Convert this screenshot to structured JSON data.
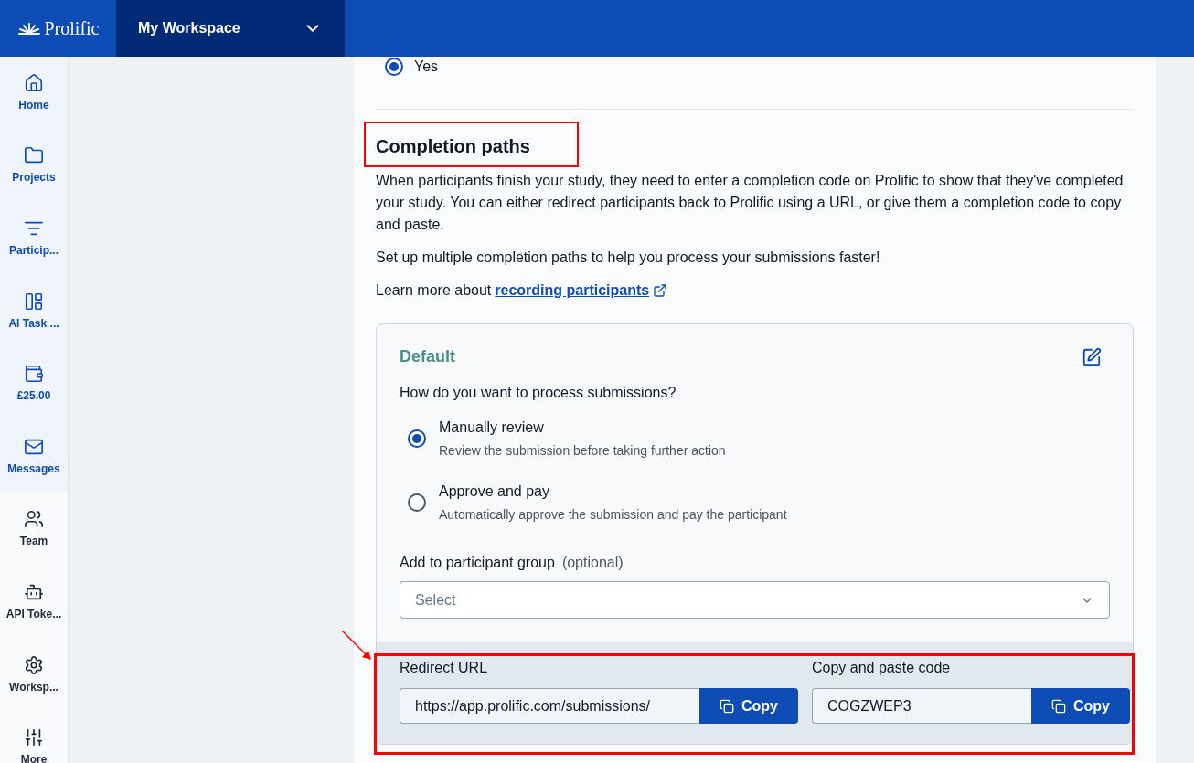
{
  "header": {
    "logo": "Prolific",
    "workspace": "My Workspace"
  },
  "sidebar": {
    "items": [
      {
        "kind": "home",
        "label": "Home",
        "highlighted": true
      },
      {
        "kind": "folder",
        "label": "Projects",
        "highlighted": true
      },
      {
        "kind": "filter",
        "label": "Particip...",
        "highlighted": true
      },
      {
        "kind": "layout",
        "label": "AI Task ...",
        "highlighted": true
      },
      {
        "kind": "wallet",
        "label": "£25.00",
        "highlighted": true
      },
      {
        "kind": "mail",
        "label": "Messages",
        "highlighted": true
      },
      {
        "kind": "users",
        "label": "Team",
        "highlighted": false
      },
      {
        "kind": "bot",
        "label": "API Toke...",
        "highlighted": false
      },
      {
        "kind": "gear",
        "label": "Worksp...",
        "highlighted": false
      },
      {
        "kind": "sliders",
        "label": "More",
        "highlighted": false
      }
    ]
  },
  "top_option": {
    "label": "Yes",
    "selected": true
  },
  "section": {
    "title": "Completion paths",
    "paragraphs": [
      "When participants finish your study, they need to enter a completion code on Prolific to show that they've completed your study. You can either redirect participants back to Prolific using a URL, or give them a completion code to copy and paste.",
      "Set up multiple completion paths to help you process your submissions faster!"
    ],
    "learn_more": {
      "text": "Learn more about",
      "link": "recording participants"
    }
  },
  "card": {
    "title": "Default",
    "question": "How do you want to process submissions?",
    "options": [
      {
        "label": "Manually review",
        "description": "Review the submission before taking further action",
        "selected": true
      },
      {
        "label": "Approve and pay",
        "description": "Automatically approve the submission and pay the participant",
        "selected": false
      }
    ],
    "group": {
      "label": "Add to participant group",
      "hint": "(optional)",
      "placeholder": "Select"
    },
    "redirect": {
      "label": "Redirect URL",
      "value": "https://app.prolific.com/submissions/",
      "button": "Copy"
    },
    "code": {
      "label": "Copy and paste code",
      "value": "COGZWEP3",
      "button": "Copy"
    }
  }
}
